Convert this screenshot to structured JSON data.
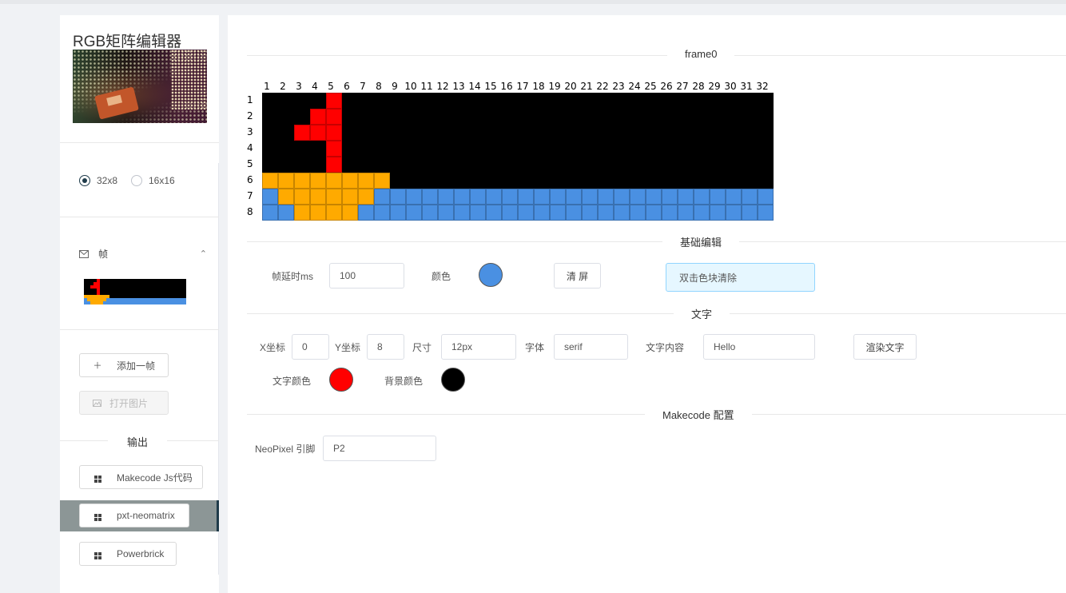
{
  "app": {
    "title": "RGB矩阵编辑器"
  },
  "size_options": [
    {
      "label": "32x8",
      "selected": true
    },
    {
      "label": "16x16",
      "selected": false
    }
  ],
  "frames_panel": {
    "icon": "mail-icon",
    "label": "帧",
    "collapse_icon": "chevron-up-icon"
  },
  "sidebar_buttons": {
    "add_frame": "添加一帧",
    "open_image": "打开图片"
  },
  "output": {
    "label": "输出",
    "items": [
      {
        "label": "Makecode Js代码",
        "icon": "windows-icon",
        "selected": false
      },
      {
        "label": "pxt-neomatrix",
        "icon": "windows-icon",
        "selected": true
      },
      {
        "label": "Powerbrick",
        "icon": "windows-icon",
        "selected": false
      }
    ]
  },
  "editor": {
    "frame_title": "frame0",
    "columns": [
      "1",
      "2",
      "3",
      "4",
      "5",
      "6",
      "7",
      "8",
      "9",
      "10",
      "11",
      "12",
      "13",
      "14",
      "15",
      "16",
      "17",
      "18",
      "19",
      "20",
      "21",
      "22",
      "23",
      "24",
      "25",
      "26",
      "27",
      "28",
      "29",
      "30",
      "31",
      "32"
    ],
    "rows": [
      "1",
      "2",
      "3",
      "4",
      "5",
      "6",
      "7",
      "8"
    ],
    "palette": {
      "K": "#000000",
      "R": "#ff0000",
      "O": "#ffaa00",
      "B": "#4a90e2"
    },
    "pixels": [
      "KKKKRKKKKKKKKKKKKKKKKKKKKKKKKKKK",
      "KKKRRKKKKKKKKKKKKKKKKKKKKKKKKKKK",
      "KKRRRKKKKKKKKKKKKKKKKKKKKKKKKKKK",
      "KKKKRKKKKKKKKKKKKKKKKKKKKKKKKKKK",
      "KKKKRKKKKKKKKKKKKKKKKKKKKKKKKKKK",
      "OOOOOOOOKKKKKKKKKKKKKKKKKKKKKKKK",
      "BOOOOOOBBBBBBBBBBBBBBBBBBBBBBBBB",
      "BBOOOOBBBBBBBBBBBBBBBBBBBBBBBBBB"
    ]
  },
  "basic_edit": {
    "title": "基础编辑",
    "delay_label": "帧延时ms",
    "delay_value": "100",
    "color_label": "颜色",
    "color_value": "#4a90e2",
    "clear_button": "清 屏",
    "tip": "双击色块清除"
  },
  "text_section": {
    "title": "文字",
    "x_label": "X坐标",
    "x_value": "0",
    "y_label": "Y坐标",
    "y_value": "8",
    "size_label": "尺寸",
    "size_value": "12px",
    "font_label": "字体",
    "font_value": "serif",
    "content_label": "文字内容",
    "content_value": "Hello",
    "render_button": "渲染文字",
    "text_color_label": "文字颜色",
    "text_color": "#ff0000",
    "bg_color_label": "背景颜色",
    "bg_color": "#000000"
  },
  "makecode": {
    "title": "Makecode 配置",
    "pin_label": "NeoPixel 引脚",
    "pin_value": "P2"
  }
}
